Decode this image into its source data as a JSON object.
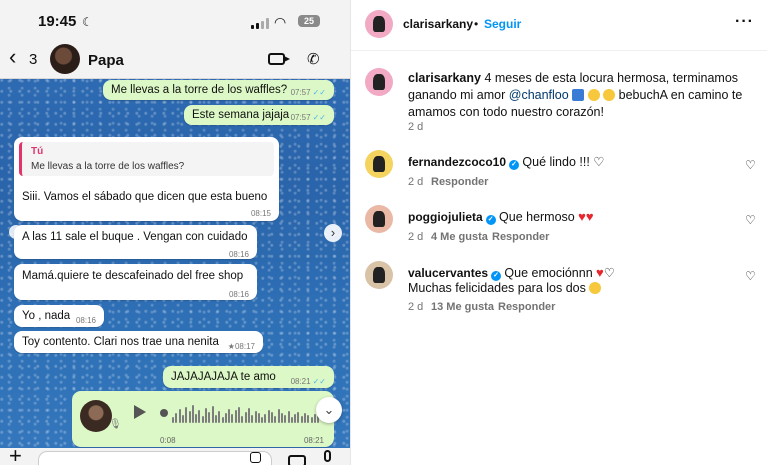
{
  "whatsapp": {
    "status": {
      "time": "19:45",
      "battery": "25"
    },
    "header": {
      "back_count": "3",
      "contact": "Papa"
    },
    "messages": [
      {
        "dir": "out",
        "text": "Me llevas a la torre de los waffles?",
        "time": "07:57"
      },
      {
        "dir": "out",
        "text": "Este semana jajaja",
        "time": "07:57"
      },
      {
        "dir": "in",
        "quote_author": "Tú",
        "quote_text": "Me llevas a la torre de los waffles?",
        "text": "Siii. Vamos el sábado que dicen que esta bueno",
        "time": "08:15"
      },
      {
        "dir": "in",
        "text": "A las 11 sale el buque . Vengan con cuidado",
        "time": "08:16"
      },
      {
        "dir": "in",
        "text": "Mamá.quiere te descafeinado del free shop",
        "time": "08:16"
      },
      {
        "dir": "in",
        "text": "Yo , nada",
        "time": "08:16"
      },
      {
        "dir": "in",
        "text": "Toy contento. Clari nos trae una nenita",
        "time": "08:17"
      },
      {
        "dir": "out",
        "text": "JAJAJAJAJA te amo",
        "time": "08:21"
      }
    ],
    "voice_note": {
      "duration": "0:08",
      "time": "08:21",
      "progress": 0.0
    }
  },
  "instagram": {
    "header": {
      "username": "clarisarkany",
      "follow_label": "Seguir",
      "separator": "•"
    },
    "caption": {
      "username": "clarisarkany",
      "text_1": "4 meses de esta locura hermosa, terminamos ganando mi amor",
      "mention": "@chanfloo",
      "text_2": "bebuchA en camino te amamos con todo nuestro corazón!",
      "age": "2 d"
    },
    "comments": [
      {
        "username": "fernandezcoco10",
        "text": "Qué lindo !!! ♡",
        "age": "2 d",
        "likes": "",
        "reply": "Responder"
      },
      {
        "username": "poggiojulieta",
        "text": "Que hermoso",
        "age": "2 d",
        "likes": "4 Me gusta",
        "reply": "Responder"
      },
      {
        "username": "valucervantes",
        "text": "Que emociónnn",
        "text_2": "Muchas felicidades para los dos",
        "age": "2 d",
        "likes": "13 Me gusta",
        "reply": "Responder"
      }
    ]
  },
  "colors": {
    "wa_out": "#dcf8c6",
    "wa_in": "#ffffff",
    "ig_blue": "#0095f6",
    "quote_pink": "#e0356b"
  }
}
